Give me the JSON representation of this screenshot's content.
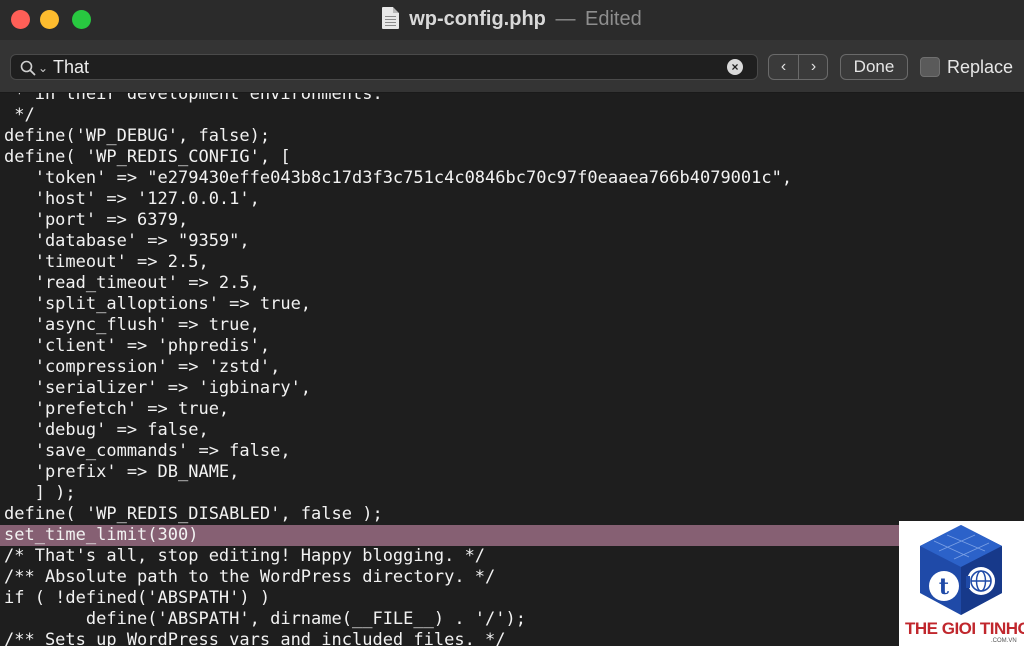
{
  "window": {
    "title": "wp-config.php",
    "separator": "—",
    "status": "Edited"
  },
  "findbar": {
    "search_value": "That",
    "prev_label": "‹",
    "next_label": "›",
    "done_label": "Done",
    "replace_label": "Replace",
    "replace_checked": false
  },
  "editor": {
    "lines": [
      " * in their development environments.",
      " */",
      "define('WP_DEBUG', false);",
      "define( 'WP_REDIS_CONFIG', [",
      "   'token' => \"e279430effe043b8c17d3f3c751c4c0846bc70c97f0eaaea766b4079001c\",",
      "   'host' => '127.0.0.1',",
      "   'port' => 6379,",
      "   'database' => \"9359\",",
      "   'timeout' => 2.5,",
      "   'read_timeout' => 2.5,",
      "   'split_alloptions' => true,",
      "   'async_flush' => true,",
      "   'client' => 'phpredis',",
      "   'compression' => 'zstd',",
      "   'serializer' => 'igbinary',",
      "   'prefetch' => true,",
      "   'debug' => false,",
      "   'save_commands' => false,",
      "   'prefix' => DB_NAME,",
      "   ] );",
      "define( 'WP_REDIS_DISABLED', false );",
      "set_time_limit(300)",
      "/* That's all, stop editing! Happy blogging. */",
      "/** Absolute path to the WordPress directory. */",
      "if ( !defined('ABSPATH') )",
      "        define('ABSPATH', dirname(__FILE__) . '/');",
      "/** Sets up WordPress vars and included files. */"
    ],
    "highlighted_line": 21,
    "highlight_color": "#866073"
  },
  "logo": {
    "text": "THE GIOI TINHOC",
    "sub": ".COM.VN",
    "icon": "cube-t-globe-icon"
  }
}
